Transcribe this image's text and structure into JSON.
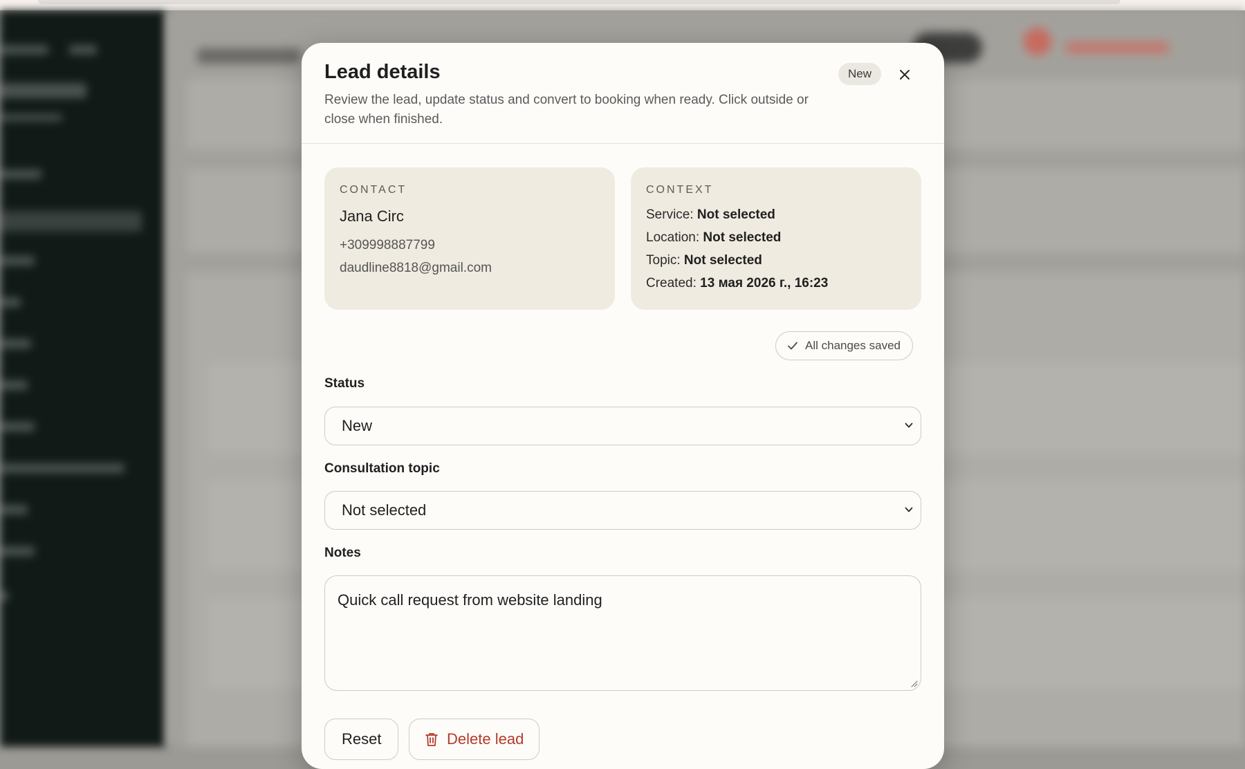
{
  "modal": {
    "title": "Lead details",
    "subtitle": "Review the lead, update status and convert to booking when ready. Click outside or close when finished.",
    "status_badge": "New",
    "close_icon": "close-icon"
  },
  "contact": {
    "label": "CONTACT",
    "name": "Jana Circ",
    "phone": "+309998887799",
    "email": "daudline8818@gmail.com"
  },
  "context": {
    "label": "CONTEXT",
    "service_label": "Service:",
    "service_value": "Not selected",
    "location_label": "Location:",
    "location_value": "Not selected",
    "topic_label": "Topic:",
    "topic_value": "Not selected",
    "created_label": "Created:",
    "created_value": "13 мая 2026 г., 16:23"
  },
  "save_state": {
    "label": "All changes saved",
    "icon": "check-icon"
  },
  "form": {
    "status_label": "Status",
    "status_value": "New",
    "topic_label": "Consultation topic",
    "topic_value": "Not selected",
    "notes_label": "Notes",
    "notes_value": "Quick call request from website landing"
  },
  "actions": {
    "reset_label": "Reset",
    "delete_label": "Delete lead",
    "delete_icon": "trash-icon"
  },
  "colors": {
    "modal_bg": "#fdfcf9",
    "card_bg": "#f0ebe1",
    "danger": "#b53a2a",
    "sidebar_bg": "#111a17"
  }
}
